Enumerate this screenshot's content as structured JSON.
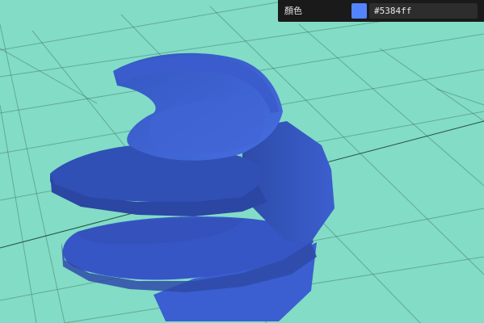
{
  "scene": {
    "background_color": "#82dcc6",
    "grid_color": "#1f3b35",
    "object": "coiled-spring-mesh"
  },
  "controls": {
    "color_label": "顏色",
    "color_value": "#5384ff",
    "swatch_color": "#5384ff"
  }
}
